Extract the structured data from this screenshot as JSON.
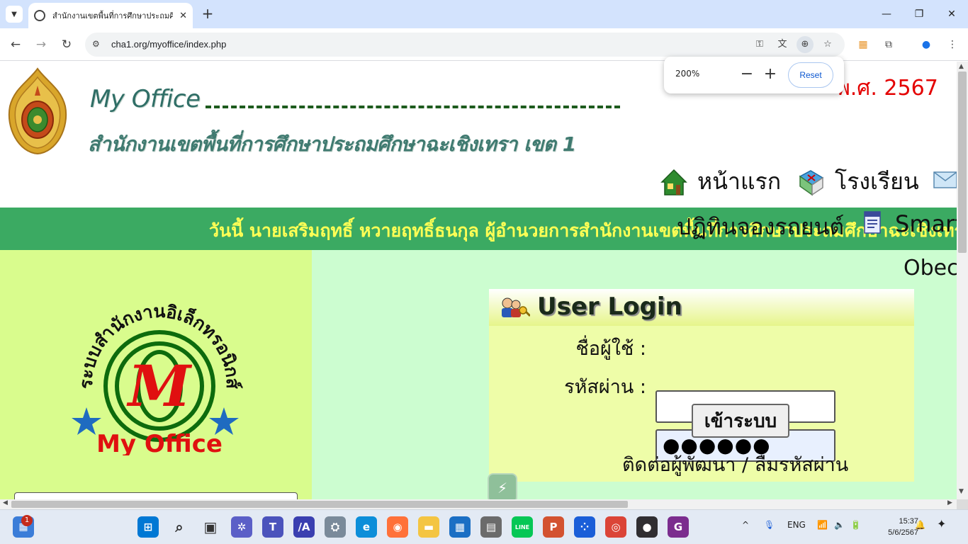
{
  "browser": {
    "tab_title": "สำนักงานเขตพื้นที่การศึกษาประถมศึ",
    "tab_close": "✕",
    "new_tab": "+",
    "url": "cha1.org/myoffice/index.php",
    "zoom": {
      "level": "200%",
      "minus": "−",
      "plus": "+",
      "reset_label": "Reset"
    }
  },
  "header": {
    "logo_title": "My Office",
    "logo_subtitle": "สำนักงานเขตพื้นที่การศึกษาประถมศึกษาฉะเชิงเทรา เขต 1",
    "date_visible": "พ.ศ.  2567",
    "nav": [
      {
        "label": "หน้าแรก",
        "icon": "home-icon"
      },
      {
        "label": "โรงเรียน",
        "icon": "map-icon"
      }
    ],
    "overlap_text": "ปฏิทินจองรถยนต์",
    "overlap_smart": "Smart",
    "obec_text": "Obec"
  },
  "marquee": {
    "text": "วันนี้ นายเสริมฤทธิ์ หวายฤทธิ์ธนกุล ผู้อำนวยการสำนักงานเขตพื้นที่การศึกษาประถมศึกษาฉะเชิงเทรา"
  },
  "emblem": {
    "arc_text": "ระบบสำนักงานอิเล็กทรอนิกส์",
    "letter": "M",
    "caption": "My Office"
  },
  "login": {
    "title": "User Login",
    "username_label": "ชื่อผู้ใช้ :",
    "username_value": "",
    "password_label": "รหัสผ่าน :",
    "password_value": "●●●●●●",
    "submit_label": "เข้าระบบ",
    "help_link": "ติดต่อผู้พัฒนา / ลืมรหัสผ่าน"
  },
  "taskbar": {
    "notification_count": "1",
    "apps": [
      {
        "name": "start-icon",
        "label": "⊞",
        "color": "#0078d4"
      },
      {
        "name": "search-icon",
        "label": "⌕",
        "color": "#333333"
      },
      {
        "name": "task-view-icon",
        "label": "▣",
        "color": "#333333"
      },
      {
        "name": "pinwheel-app-icon",
        "label": "✲",
        "color": "#5b5fc7"
      },
      {
        "name": "teams-icon",
        "label": "T",
        "color": "#4b53bc"
      },
      {
        "name": "vector-app-icon",
        "label": "/A",
        "color": "#3a3fb0"
      },
      {
        "name": "network-app-icon",
        "label": "⛭",
        "color": "#7a8a9a"
      },
      {
        "name": "edge-icon",
        "label": "e",
        "color": "#0c8ed9"
      },
      {
        "name": "firefox-icon",
        "label": "◉",
        "color": "#ff7139"
      },
      {
        "name": "file-explorer-icon",
        "label": "▬",
        "color": "#f4c542"
      },
      {
        "name": "store-icon",
        "label": "▦",
        "color": "#1b6fc4"
      },
      {
        "name": "calculator-icon",
        "label": "▤",
        "color": "#6b6b6b"
      },
      {
        "name": "line-icon",
        "label": "LINE",
        "color": "#06c755"
      },
      {
        "name": "powerpoint-icon",
        "label": "P",
        "color": "#d35230"
      },
      {
        "name": "dice-app-icon",
        "label": "⁘",
        "color": "#1a5ed8"
      },
      {
        "name": "chrome-icon",
        "label": "◎",
        "color": "#db4437"
      },
      {
        "name": "obs-icon",
        "label": "●",
        "color": "#302e31"
      },
      {
        "name": "pdf-app-icon",
        "label": "G",
        "color": "#7b2d8e"
      }
    ],
    "tray": {
      "chevron": "^",
      "mic": "🎙",
      "language": "ENG",
      "wifi": "📶",
      "volume": "🔈",
      "battery": "🔋"
    },
    "time": "15:37",
    "date": "5/6/2567"
  }
}
